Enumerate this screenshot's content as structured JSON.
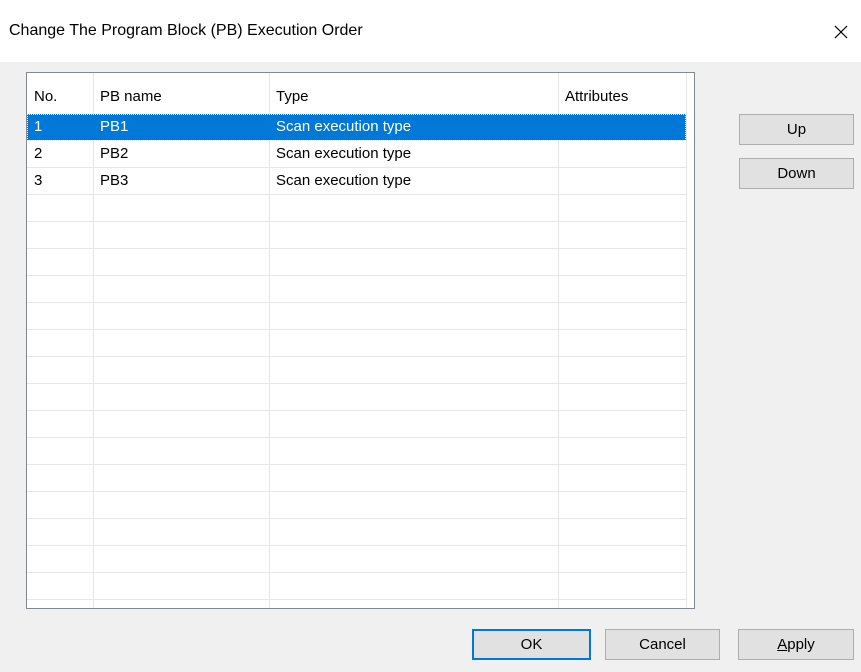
{
  "window": {
    "title": "Change The Program Block (PB) Execution Order",
    "close_icon": "close-icon"
  },
  "table": {
    "columns": [
      "No.",
      "PB name",
      "Type",
      "Attributes"
    ],
    "rows": [
      {
        "no": "1",
        "name": "PB1",
        "type": "Scan execution type",
        "attributes": "",
        "selected": true
      },
      {
        "no": "2",
        "name": "PB2",
        "type": "Scan execution type",
        "attributes": "",
        "selected": false
      },
      {
        "no": "3",
        "name": "PB3",
        "type": "Scan execution type",
        "attributes": "",
        "selected": false
      }
    ],
    "selection_color": "#0078d7"
  },
  "side_buttons": {
    "up_label": "Up",
    "down_label": "Down"
  },
  "footer": {
    "ok_label": "OK",
    "cancel_label": "Cancel",
    "apply_label_accel": "A",
    "apply_label_rest": "pply"
  }
}
